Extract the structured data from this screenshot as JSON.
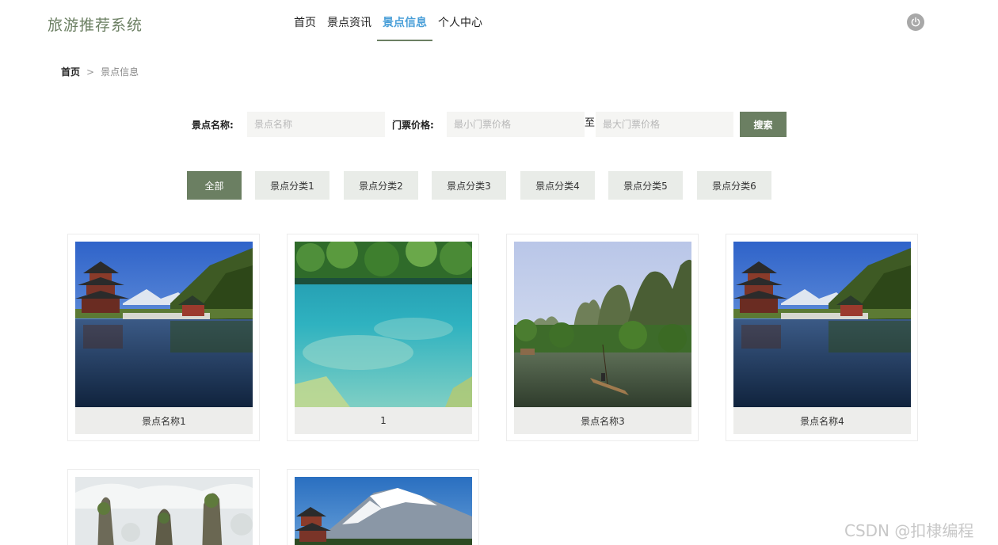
{
  "header": {
    "logo": "旅游推荐系统",
    "nav": [
      {
        "label": "首页",
        "active": false
      },
      {
        "label": "景点资讯",
        "active": false
      },
      {
        "label": "景点信息",
        "active": true
      },
      {
        "label": "个人中心",
        "active": false
      }
    ],
    "power_icon": "power-icon"
  },
  "breadcrumb": {
    "home": "首页",
    "separator": ">",
    "current": "景点信息"
  },
  "search": {
    "name_label": "景点名称:",
    "name_placeholder": "景点名称",
    "price_label": "门票价格:",
    "min_placeholder": "最小门票价格",
    "to_label": "至",
    "max_placeholder": "最大门票价格",
    "button": "搜索"
  },
  "categories": [
    {
      "label": "全部",
      "active": true
    },
    {
      "label": "景点分类1",
      "active": false
    },
    {
      "label": "景点分类2",
      "active": false
    },
    {
      "label": "景点分类3",
      "active": false
    },
    {
      "label": "景点分类4",
      "active": false
    },
    {
      "label": "景点分类5",
      "active": false
    },
    {
      "label": "景点分类6",
      "active": false
    }
  ],
  "spots": [
    {
      "name": "景点名称1",
      "image": "pagoda-lake"
    },
    {
      "name": "1",
      "image": "turquoise-lake"
    },
    {
      "name": "景点名称3",
      "image": "karst-river"
    },
    {
      "name": "景点名称4",
      "image": "pagoda-lake"
    },
    {
      "name": "",
      "image": "stone-pillars"
    },
    {
      "name": "",
      "image": "snow-mountain"
    }
  ],
  "watermark": "CSDN @扣棣编程",
  "colors": {
    "brand": "#6b7f62",
    "active_nav": "#4a9fd8",
    "muted_bg": "#e9ece8"
  }
}
